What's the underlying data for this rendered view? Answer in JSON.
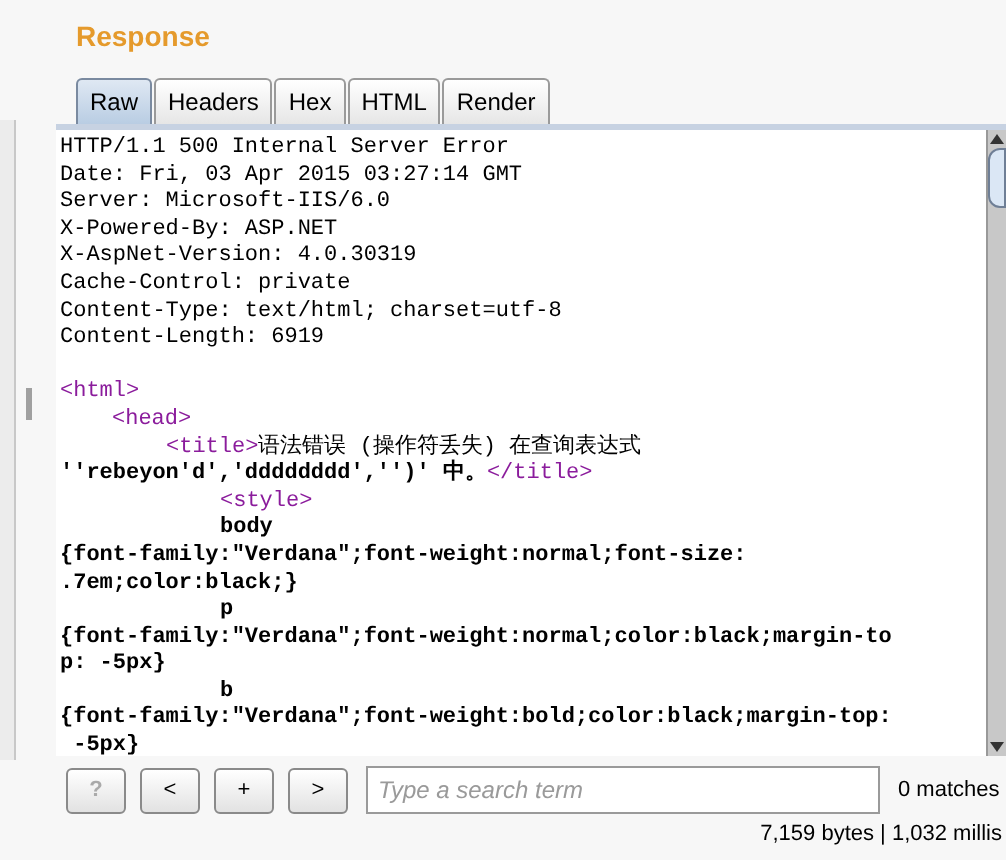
{
  "section_title": "Response",
  "tabs": [
    {
      "label": "Raw",
      "selected": true
    },
    {
      "label": "Headers",
      "selected": false
    },
    {
      "label": "Hex",
      "selected": false
    },
    {
      "label": "HTML",
      "selected": false
    },
    {
      "label": "Render",
      "selected": false
    }
  ],
  "lines": [
    {
      "kind": "flush",
      "segments": [
        {
          "kind": "text",
          "text": "HTTP/1.1 500 Internal Server Error"
        }
      ]
    },
    {
      "kind": "flush",
      "segments": [
        {
          "kind": "text",
          "text": "Date: Fri, 03 Apr 2015 03:27:14 GMT"
        }
      ]
    },
    {
      "kind": "flush",
      "segments": [
        {
          "kind": "text",
          "text": "Server: Microsoft-IIS/6.0"
        }
      ]
    },
    {
      "kind": "flush",
      "segments": [
        {
          "kind": "text",
          "text": "X-Powered-By: ASP.NET"
        }
      ]
    },
    {
      "kind": "flush",
      "segments": [
        {
          "kind": "text",
          "text": "X-AspNet-Version: 4.0.30319"
        }
      ]
    },
    {
      "kind": "flush",
      "segments": [
        {
          "kind": "text",
          "text": "Cache-Control: private"
        }
      ]
    },
    {
      "kind": "flush",
      "segments": [
        {
          "kind": "text",
          "text": "Content-Type: text/html; charset=utf-8"
        }
      ]
    },
    {
      "kind": "flush",
      "segments": [
        {
          "kind": "text",
          "text": "Content-Length: 6919"
        }
      ]
    },
    {
      "kind": "blank"
    },
    {
      "kind": "flush",
      "segments": [
        {
          "kind": "tag",
          "text": "<html>"
        }
      ]
    },
    {
      "kind": "indented",
      "segments": [
        {
          "kind": "tag",
          "text": "<head>"
        }
      ]
    },
    {
      "kind": "nested",
      "segments": [
        {
          "kind": "tag",
          "text": "<title>"
        },
        {
          "kind": "text",
          "text": "语法错误 (操作符丢失) 在查询表达式"
        }
      ]
    },
    {
      "kind": "flush",
      "segments": [
        {
          "kind": "bold",
          "text": "''rebeyon'd','dddddddd','')' 中。"
        },
        {
          "kind": "tag",
          "text": "</title>"
        }
      ]
    },
    {
      "kind": "deep",
      "segments": [
        {
          "kind": "tag",
          "text": "<style>"
        }
      ]
    },
    {
      "kind": "deep",
      "segments": [
        {
          "kind": "bold",
          "text": "body"
        }
      ]
    },
    {
      "kind": "flush",
      "segments": [
        {
          "kind": "bold",
          "text": "{font-family:\"Verdana\";font-weight:normal;font-size:"
        }
      ]
    },
    {
      "kind": "flush",
      "segments": [
        {
          "kind": "bold",
          "text": ".7em;color:black;}"
        }
      ]
    },
    {
      "kind": "deep",
      "segments": [
        {
          "kind": "bold",
          "text": "p"
        }
      ]
    },
    {
      "kind": "flush",
      "segments": [
        {
          "kind": "bold",
          "text": "{font-family:\"Verdana\";font-weight:normal;color:black;margin-to"
        }
      ]
    },
    {
      "kind": "flush",
      "segments": [
        {
          "kind": "bold",
          "text": "p: -5px}"
        }
      ]
    },
    {
      "kind": "deep",
      "segments": [
        {
          "kind": "bold",
          "text": "b"
        }
      ]
    },
    {
      "kind": "flush",
      "segments": [
        {
          "kind": "bold",
          "text": "{font-family:\"Verdana\";font-weight:bold;color:black;margin-top:"
        }
      ]
    },
    {
      "kind": "flush",
      "segments": [
        {
          "kind": "bold",
          "text": " -5px}"
        }
      ]
    }
  ],
  "toolbar": {
    "buttons": [
      {
        "label": "?",
        "disabled": true
      },
      {
        "label": "<",
        "disabled": false
      },
      {
        "label": "+",
        "disabled": false
      },
      {
        "label": ">",
        "disabled": false
      }
    ],
    "search": {
      "placeholder": "Type a search term"
    },
    "matches": "0 matches"
  },
  "status": "7,159 bytes | 1,032 millis"
}
